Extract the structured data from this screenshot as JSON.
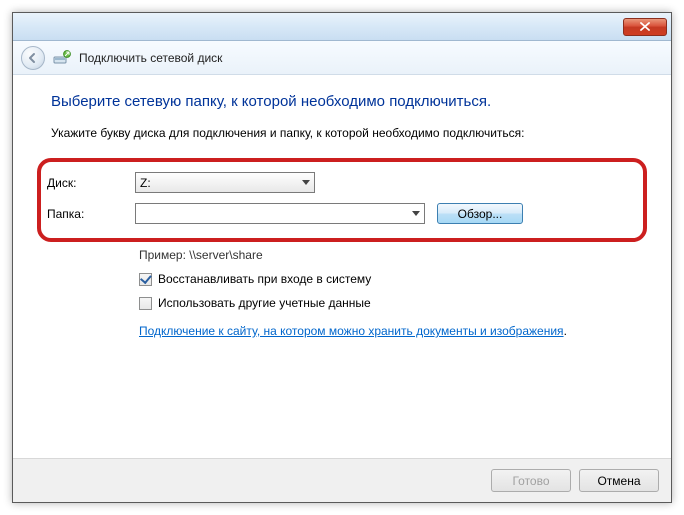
{
  "titlebar": {},
  "header": {
    "title": "Подключить сетевой диск"
  },
  "content": {
    "heading": "Выберите сетевую папку, к которой необходимо подключиться.",
    "instruction": "Укажите букву диска для подключения и папку, к которой необходимо подключиться:",
    "drive_label": "Диск:",
    "drive_value": "Z:",
    "folder_label": "Папка:",
    "folder_value": "",
    "browse_label": "Обзор...",
    "example": "Пример: \\\\server\\share",
    "reconnect_label": "Восстанавливать при входе в систему",
    "other_creds_label": "Использовать другие учетные данные",
    "link_prefix": "Подключение к сайту, на котором можно хранить документы и изображения",
    "link_suffix": "."
  },
  "footer": {
    "ok": "Готово",
    "cancel": "Отмена"
  },
  "state": {
    "reconnect_checked": true,
    "other_creds_checked": false
  }
}
